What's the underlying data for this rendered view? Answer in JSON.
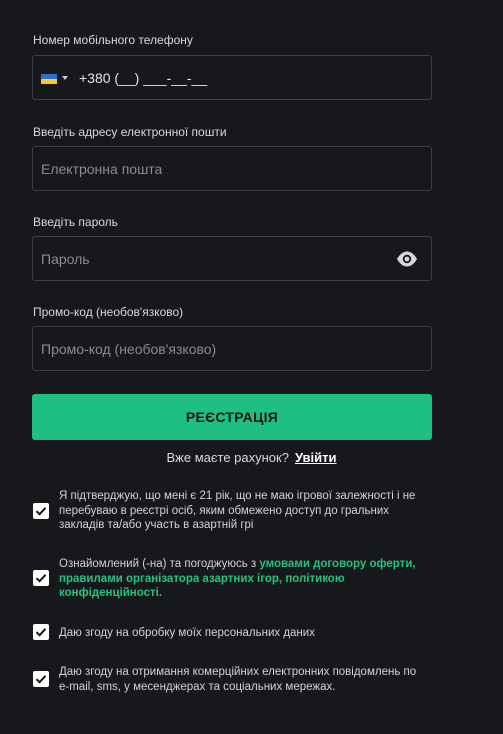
{
  "form": {
    "phone": {
      "label": "Номер мобільного телефону",
      "country": "Ukraine",
      "value": "+380 (__) ___-__-__",
      "flag_colors": [
        "#2a6fd6",
        "#f7cf1d"
      ]
    },
    "email": {
      "label": "Введіть адресу електронної пошти",
      "placeholder": "Електронна пошта"
    },
    "password": {
      "label": "Введіть пароль",
      "placeholder": "Пароль",
      "toggle_icon": "eye-icon"
    },
    "promo": {
      "label": "Промо-код (необов'язково)",
      "placeholder": "Промо-код (необов'язково)"
    },
    "submit_label": "РЕЄСТРАЦІЯ",
    "have_account_text": "Вже маєте рахунок?",
    "login_link": "Увійти"
  },
  "consents": [
    {
      "checked": true,
      "text": "Я підтверджую, що мені є 21 рік, що не маю ігрової залежності і не перебуваю в реєстрі осіб, яким обмежено доступ до гральних закладів та/або участь в азартній грі"
    },
    {
      "checked": true,
      "text_before": "Ознайомлений (-на) та погоджуюсь з ",
      "link_text": "умовами договору оферти, правилами організатора азартних ігор, політикою конфіденційності."
    },
    {
      "checked": true,
      "text": "Даю згоду на обробку моїх персональних даних"
    },
    {
      "checked": true,
      "text": "Даю згоду на отримання комерційних електронних повідомлень по e-mail, sms, у месенджерах та соціальних мережах."
    }
  ],
  "colors": {
    "background": "#17181c",
    "accent": "#1fbe83",
    "link_green": "#22c47f",
    "field_border": "#3c3e44"
  }
}
